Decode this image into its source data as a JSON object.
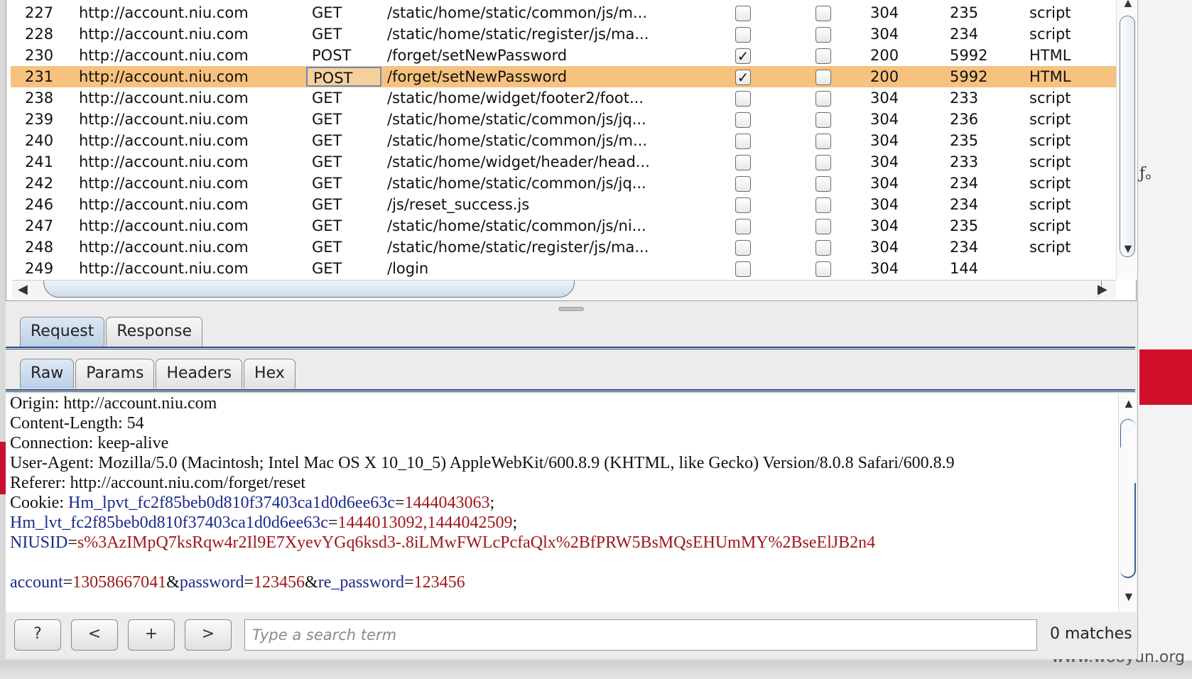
{
  "history": {
    "rows": [
      {
        "num": "227",
        "host": "http://account.niu.com",
        "method": "GET",
        "url": "/static/home/static/common/js/m...",
        "edited": false,
        "comment": false,
        "status": "304",
        "length": "235",
        "mime": "script"
      },
      {
        "num": "228",
        "host": "http://account.niu.com",
        "method": "GET",
        "url": "/static/home/static/register/js/ma...",
        "edited": false,
        "comment": false,
        "status": "304",
        "length": "234",
        "mime": "script"
      },
      {
        "num": "230",
        "host": "http://account.niu.com",
        "method": "POST",
        "url": "/forget/setNewPassword",
        "edited": true,
        "comment": false,
        "status": "200",
        "length": "5992",
        "mime": "HTML"
      },
      {
        "num": "231",
        "host": "http://account.niu.com",
        "method": "POST",
        "url": "/forget/setNewPassword",
        "edited": true,
        "comment": false,
        "status": "200",
        "length": "5992",
        "mime": "HTML",
        "selected": true
      },
      {
        "num": "238",
        "host": "http://account.niu.com",
        "method": "GET",
        "url": "/static/home/widget/footer2/foot...",
        "edited": false,
        "comment": false,
        "status": "304",
        "length": "233",
        "mime": "script"
      },
      {
        "num": "239",
        "host": "http://account.niu.com",
        "method": "GET",
        "url": "/static/home/static/common/js/jq...",
        "edited": false,
        "comment": false,
        "status": "304",
        "length": "236",
        "mime": "script"
      },
      {
        "num": "240",
        "host": "http://account.niu.com",
        "method": "GET",
        "url": "/static/home/static/common/js/m...",
        "edited": false,
        "comment": false,
        "status": "304",
        "length": "235",
        "mime": "script"
      },
      {
        "num": "241",
        "host": "http://account.niu.com",
        "method": "GET",
        "url": "/static/home/widget/header/head...",
        "edited": false,
        "comment": false,
        "status": "304",
        "length": "233",
        "mime": "script"
      },
      {
        "num": "242",
        "host": "http://account.niu.com",
        "method": "GET",
        "url": "/static/home/static/common/js/jq...",
        "edited": false,
        "comment": false,
        "status": "304",
        "length": "234",
        "mime": "script"
      },
      {
        "num": "246",
        "host": "http://account.niu.com",
        "method": "GET",
        "url": "/js/reset_success.js",
        "edited": false,
        "comment": false,
        "status": "304",
        "length": "234",
        "mime": "script"
      },
      {
        "num": "247",
        "host": "http://account.niu.com",
        "method": "GET",
        "url": "/static/home/static/common/js/ni...",
        "edited": false,
        "comment": false,
        "status": "304",
        "length": "235",
        "mime": "script"
      },
      {
        "num": "248",
        "host": "http://account.niu.com",
        "method": "GET",
        "url": "/static/home/static/register/js/ma...",
        "edited": false,
        "comment": false,
        "status": "304",
        "length": "234",
        "mime": "script"
      },
      {
        "num": "249",
        "host": "http://account.niu.com",
        "method": "GET",
        "url": "/login",
        "edited": false,
        "comment": false,
        "status": "304",
        "length": "144",
        "mime": ""
      }
    ]
  },
  "tabs": {
    "request": "Request",
    "response": "Response"
  },
  "subtabs": {
    "raw": "Raw",
    "params": "Params",
    "headers": "Headers",
    "hex": "Hex"
  },
  "raw": {
    "origin": "Origin: http://account.niu.com",
    "content_length": "Content-Length: 54",
    "connection": "Connection: keep-alive",
    "user_agent": "User-Agent: Mozilla/5.0 (Macintosh; Intel Mac OS X 10_10_5) AppleWebKit/600.8.9 (KHTML, like Gecko) Version/8.0.8 Safari/600.8.9",
    "referer": "Referer: http://account.niu.com/forget/reset",
    "cookie_prefix": "Cookie: ",
    "cookie1_key": "Hm_lpvt_fc2f85beb0d810f37403ca1d0d6ee63c",
    "cookie1_val": "1444043063",
    "cookie2_key": "Hm_lvt_fc2f85beb0d810f37403ca1d0d6ee63c",
    "cookie2_val": "1444013092,1444042509",
    "cookie3_key": "NIUSID",
    "cookie3_val": "s%3AzIMpQ7ksRqw4r2Il9E7XyevYGq6ksd3-.8iLMwFWLcPcfaQlx%2BfPRW5BsMQsEHUmMY%2BseElJB2n4",
    "body_k1": "account",
    "body_v1": "13058667041",
    "body_k2": "password",
    "body_v2": "123456",
    "body_k3": "re_password",
    "body_v3": "123456"
  },
  "search": {
    "help": "?",
    "prev": "<",
    "add": "+",
    "next": ">",
    "placeholder": "Type a search term",
    "matches": "0 matches"
  },
  "watermark": "www.wooyun.org",
  "background": {
    "glyph": "ƒ。"
  },
  "colors": {
    "selected_row": "#f7c17e",
    "param_key": "#1a2a8c",
    "param_value": "#a0161c",
    "accent_rule": "#2d4f7c"
  }
}
